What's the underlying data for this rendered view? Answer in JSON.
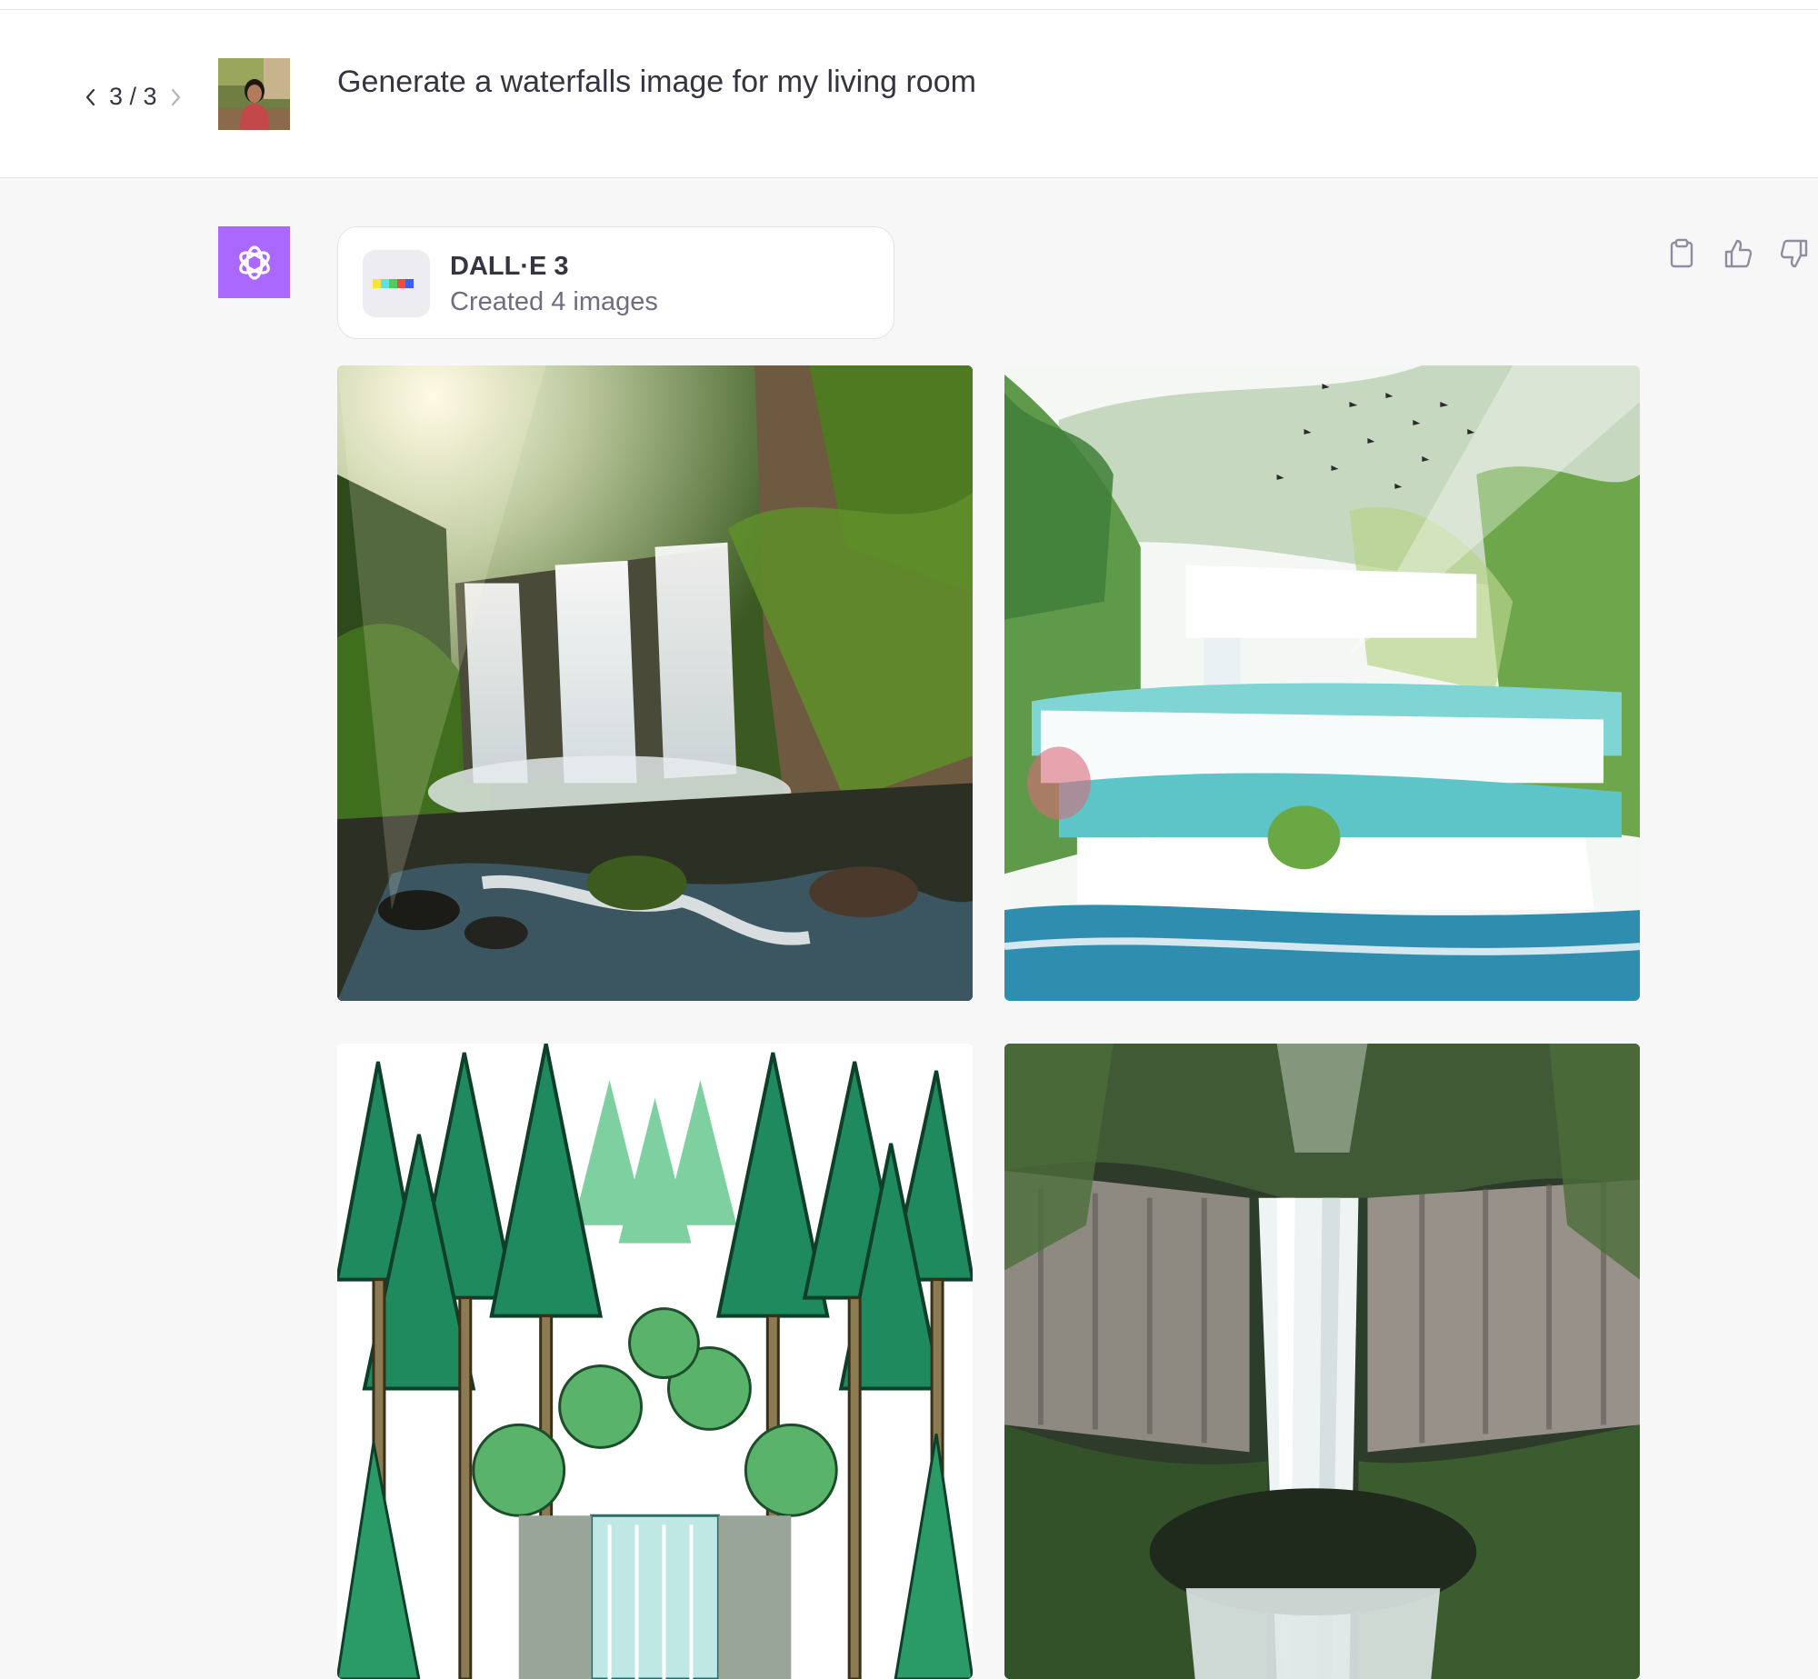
{
  "pager": {
    "label": "3 / 3"
  },
  "user_message": {
    "text": "Generate a waterfalls image for my living room"
  },
  "assistant": {
    "tool": {
      "name": "DALL·E 3",
      "status": "Created 4 images"
    },
    "brand_color": "#ab68ff",
    "actions": [
      {
        "icon": "clipboard-icon"
      },
      {
        "icon": "thumbs-up-icon"
      },
      {
        "icon": "thumbs-down-icon"
      }
    ],
    "images": [
      {
        "id": "image-1",
        "style": "photoreal jungle waterfall"
      },
      {
        "id": "image-2",
        "style": "watercolor tiered waterfall"
      },
      {
        "id": "image-3",
        "style": "illustrated pine forest waterfall"
      },
      {
        "id": "image-4",
        "style": "photoreal cliff waterfall"
      }
    ]
  }
}
